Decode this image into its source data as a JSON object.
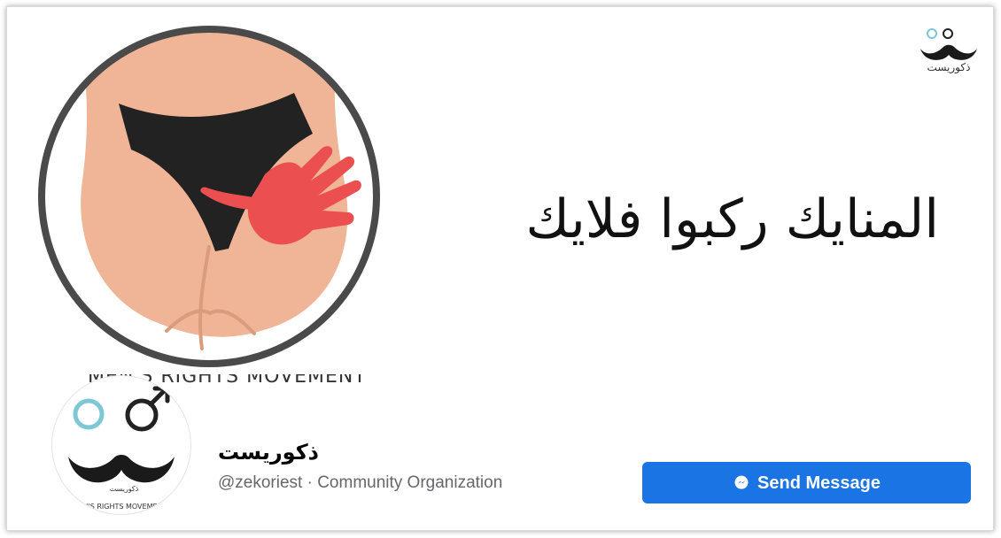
{
  "cover": {
    "caption": "MEN'S RIGHTS MOVEMENT",
    "arabic_text": "المنايك ركبوا فلايك",
    "corner_logo_text": "ذكوريست"
  },
  "profile": {
    "avatar_caption": "MEN'S RIGHTS MOVEMENT",
    "avatar_arabic_text": "ذكوريست",
    "name": "ذكوريست",
    "meta": "@zekoriest · Community Organization"
  },
  "actions": {
    "send_message_label": "Send Message"
  },
  "colors": {
    "primary_button": "#1b74e4",
    "ring": "#4a4a4a",
    "skin": "#efb596",
    "hand": "#ec4f4f",
    "cyan_symbol": "#7ec8d4"
  },
  "icons": {
    "messenger": "messenger-icon"
  }
}
